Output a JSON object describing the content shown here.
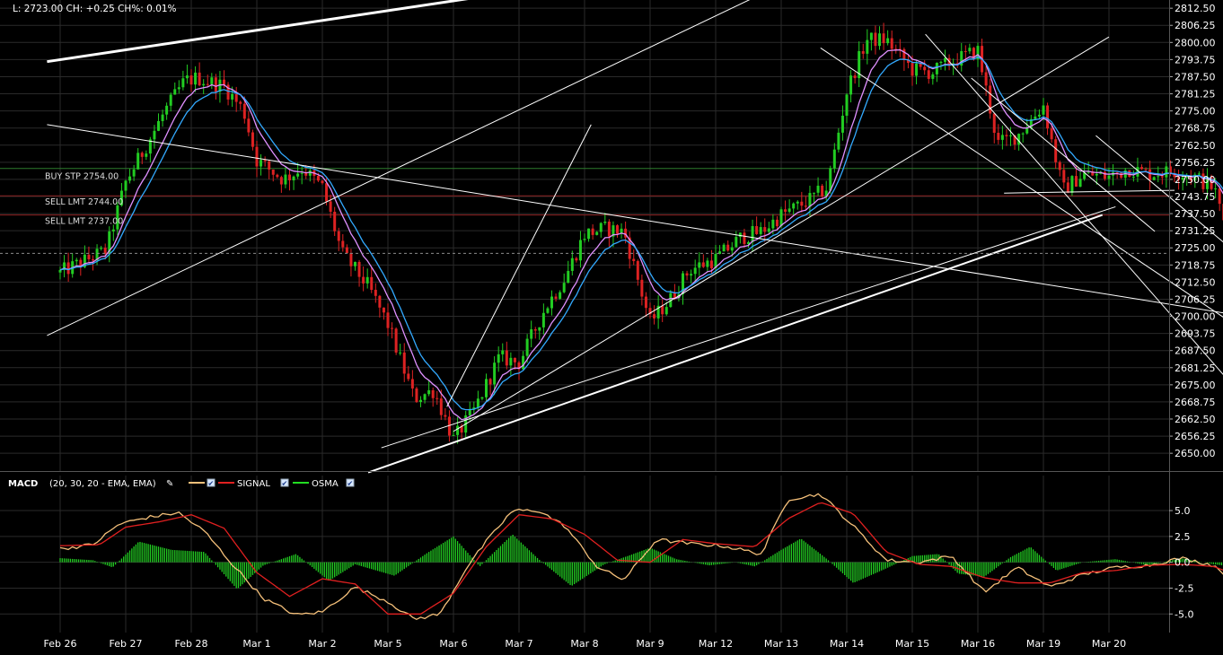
{
  "status": {
    "text": "L: 2723.00 CH: +0.25 CH%: 0.01%"
  },
  "order_lines": [
    {
      "label": "BUY STP 2754.00",
      "price": 2754.0,
      "color": "#2e7d2e"
    },
    {
      "label": "SELL LMT 2744.00",
      "price": 2744.0,
      "color": "#8b1e1e"
    },
    {
      "label": "SELL LMT 2737.00",
      "price": 2737.0,
      "color": "#8b1e1e"
    }
  ],
  "last_price": 2723.0,
  "macd_header": {
    "title": "MACD",
    "params": "(20, 30, 20 - EMA, EMA)",
    "legend": [
      {
        "name": "",
        "color": "#f5c07a"
      },
      {
        "name": "SIGNAL",
        "color": "#e02020"
      },
      {
        "name": "OSMA",
        "color": "#22dd22"
      }
    ]
  },
  "colors": {
    "background": "#000000",
    "grid": "#2a2a2a",
    "up_candle": "#22cc22",
    "down_candle": "#dd2222",
    "ma_fast": "#e090ff",
    "ma_slow": "#33aaff",
    "trendline": "#ffffff",
    "separator": "#555555"
  },
  "chart_data": [
    {
      "type": "candlestick",
      "title": "",
      "price_axis": {
        "ylim": [
          2643.5,
          2815.5
        ],
        "ticks": [
          2812.5,
          2806.25,
          2800.0,
          2793.75,
          2787.5,
          2781.25,
          2775.0,
          2768.75,
          2762.5,
          2756.25,
          2750.0,
          2743.75,
          2737.5,
          2731.25,
          2725.0,
          2718.75,
          2712.5,
          2706.25,
          2700.0,
          2693.75,
          2687.5,
          2681.25,
          2675.0,
          2668.75,
          2662.5,
          2656.25,
          2650.0
        ],
        "tick_labels": [
          "2812.50",
          "2806.25",
          "2800.00",
          "2793.75",
          "2787.50",
          "2781.25",
          "2775.00",
          "2768.75",
          "2762.50",
          "2756.25",
          "2750.00",
          "2743.75",
          "2737.50",
          "2731.25",
          "2725.00",
          "2718.75",
          "2712.50",
          "2706.25",
          "2700.00",
          "2693.75",
          "2687.50",
          "2681.25",
          "2675.00",
          "2668.75",
          "2662.50",
          "2656.25",
          "2650.00"
        ]
      },
      "date_axis": {
        "labels": [
          "Feb 26",
          "Feb 27",
          "Feb 28",
          "Mar 1",
          "Mar 2",
          "Mar 5",
          "Mar 6",
          "Mar 7",
          "Mar 8",
          "Mar 9",
          "Mar 12",
          "Mar 13",
          "Mar 14",
          "Mar 15",
          "Mar 16",
          "Mar 19",
          "Mar 20"
        ],
        "grid": true
      },
      "price_path": [
        [
          0,
          2716
        ],
        [
          0.7,
          2724
        ],
        [
          1.0,
          2749
        ],
        [
          1.35,
          2764
        ],
        [
          1.6,
          2775
        ],
        [
          1.9,
          2786
        ],
        [
          2.1,
          2787
        ],
        [
          2.5,
          2784
        ],
        [
          2.8,
          2775
        ],
        [
          3.0,
          2757
        ],
        [
          3.4,
          2750
        ],
        [
          3.7,
          2754
        ],
        [
          4.0,
          2747
        ],
        [
          4.3,
          2723
        ],
        [
          4.7,
          2711
        ],
        [
          5.0,
          2697
        ],
        [
          5.4,
          2670
        ],
        [
          5.7,
          2673
        ],
        [
          6.0,
          2655
        ],
        [
          6.3,
          2665
        ],
        [
          6.7,
          2685
        ],
        [
          7.0,
          2683
        ],
        [
          7.4,
          2703
        ],
        [
          7.7,
          2714
        ],
        [
          8.0,
          2730
        ],
        [
          8.3,
          2732
        ],
        [
          8.6,
          2731
        ],
        [
          9.0,
          2698
        ],
        [
          9.3,
          2706
        ],
        [
          9.6,
          2717
        ],
        [
          10.0,
          2721
        ],
        [
          10.4,
          2729
        ],
        [
          10.7,
          2731
        ],
        [
          11.0,
          2737
        ],
        [
          11.4,
          2742
        ],
        [
          11.7,
          2747
        ],
        [
          12.0,
          2782
        ],
        [
          12.3,
          2801
        ],
        [
          12.6,
          2801
        ],
        [
          13.0,
          2790
        ],
        [
          13.3,
          2789
        ],
        [
          13.6,
          2793
        ],
        [
          14.0,
          2797
        ],
        [
          14.3,
          2763
        ],
        [
          14.6,
          2766
        ],
        [
          15.0,
          2777
        ],
        [
          15.3,
          2746
        ],
        [
          15.6,
          2752
        ],
        [
          16.0,
          2751
        ],
        [
          16.3,
          2754
        ],
        [
          16.6,
          2752
        ],
        [
          17.0,
          2753
        ],
        [
          17.3,
          2751
        ],
        [
          17.6,
          2747
        ],
        [
          18.0,
          2716
        ],
        [
          18.3,
          2701
        ],
        [
          18.6,
          2723
        ],
        [
          19.0,
          2726
        ],
        [
          19.3,
          2725
        ],
        [
          19.6,
          2724
        ],
        [
          20.2,
          2723
        ]
      ],
      "trendlines": [
        {
          "from": [
            -0.2,
            2793
          ],
          "to": [
            9.3,
            2827
          ],
          "width": 3
        },
        {
          "from": [
            -0.2,
            2770
          ],
          "to": [
            18.6,
            2698
          ],
          "width": 1
        },
        {
          "from": [
            -0.2,
            2693
          ],
          "to": [
            11.6,
            2828
          ],
          "width": 1
        },
        {
          "from": [
            5.9,
            2667
          ],
          "to": [
            8.1,
            2770
          ],
          "width": 1
        },
        {
          "from": [
            6.0,
            2658
          ],
          "to": [
            16.0,
            2802
          ],
          "width": 1
        },
        {
          "from": [
            4.7,
            2643
          ],
          "to": [
            15.9,
            2737
          ],
          "width": 2
        },
        {
          "from": [
            4.9,
            2652
          ],
          "to": [
            16.1,
            2740
          ],
          "width": 1
        },
        {
          "from": [
            11.6,
            2798
          ],
          "to": [
            18.1,
            2694
          ],
          "width": 1
        },
        {
          "from": [
            13.2,
            2803
          ],
          "to": [
            18.1,
            2669
          ],
          "width": 1
        },
        {
          "from": [
            13.9,
            2787
          ],
          "to": [
            16.7,
            2731
          ],
          "width": 1
        },
        {
          "from": [
            15.8,
            2766
          ],
          "to": [
            17.9,
            2724
          ],
          "width": 1
        },
        {
          "from": [
            14.4,
            2745
          ],
          "to": [
            17.0,
            2746
          ],
          "width": 1
        }
      ]
    },
    {
      "type": "line",
      "title": "MACD",
      "y_axis": {
        "ylim": [
          -6.8,
          7.0
        ],
        "ticks": [
          5.0,
          2.5,
          0.0,
          -2.5,
          -5.0
        ],
        "tick_labels": [
          "5.0",
          "2.5",
          "0.0",
          "-2.5",
          "-5.0"
        ]
      },
      "series": [
        {
          "name": "",
          "path": [
            [
              0,
              1.3
            ],
            [
              0.5,
              1.7
            ],
            [
              0.9,
              3.7
            ],
            [
              1.3,
              4.3
            ],
            [
              1.8,
              4.8
            ],
            [
              2.2,
              3.0
            ],
            [
              2.6,
              0.0
            ],
            [
              3.1,
              -3.5
            ],
            [
              3.6,
              -5.1
            ],
            [
              4.0,
              -4.8
            ],
            [
              4.5,
              -2.4
            ],
            [
              5.0,
              -3.8
            ],
            [
              5.4,
              -5.5
            ],
            [
              5.8,
              -5.0
            ],
            [
              6.2,
              -0.5
            ],
            [
              6.5,
              2.0
            ],
            [
              6.9,
              5.0
            ],
            [
              7.3,
              5.0
            ],
            [
              7.7,
              3.5
            ],
            [
              8.2,
              -0.5
            ],
            [
              8.6,
              -1.7
            ],
            [
              9.1,
              2.2
            ],
            [
              9.6,
              1.8
            ],
            [
              10.1,
              1.6
            ],
            [
              10.7,
              0.8
            ],
            [
              11.1,
              6.1
            ],
            [
              11.6,
              6.6
            ],
            [
              12.1,
              3.5
            ],
            [
              12.6,
              0.2
            ],
            [
              13.1,
              0.0
            ],
            [
              13.6,
              0.6
            ],
            [
              14.1,
              -2.9
            ],
            [
              14.6,
              -0.5
            ],
            [
              15.1,
              -2.4
            ],
            [
              15.6,
              -1.2
            ],
            [
              16.1,
              -0.5
            ],
            [
              16.6,
              -0.3
            ],
            [
              17.1,
              0.4
            ],
            [
              17.6,
              -0.3
            ],
            [
              18.1,
              -2.8
            ],
            [
              18.5,
              -5.9
            ],
            [
              19.0,
              -3.4
            ],
            [
              19.5,
              -1.0
            ],
            [
              20.2,
              -0.6
            ]
          ]
        },
        {
          "name": "SIGNAL",
          "path": [
            [
              0,
              1.6
            ],
            [
              0.6,
              1.7
            ],
            [
              1.0,
              3.4
            ],
            [
              1.5,
              3.9
            ],
            [
              2.0,
              4.6
            ],
            [
              2.5,
              3.3
            ],
            [
              3.0,
              -1.0
            ],
            [
              3.5,
              -3.3
            ],
            [
              4.0,
              -1.6
            ],
            [
              4.5,
              -2.1
            ],
            [
              5.0,
              -5.0
            ],
            [
              5.5,
              -5.0
            ],
            [
              6.0,
              -3.0
            ],
            [
              6.5,
              1.5
            ],
            [
              7.0,
              4.6
            ],
            [
              7.5,
              4.2
            ],
            [
              8.0,
              2.7
            ],
            [
              8.5,
              0.2
            ],
            [
              9.0,
              0.0
            ],
            [
              9.5,
              2.2
            ],
            [
              10.0,
              1.8
            ],
            [
              10.6,
              1.5
            ],
            [
              11.1,
              4.2
            ],
            [
              11.6,
              5.8
            ],
            [
              12.1,
              4.7
            ],
            [
              12.6,
              1.0
            ],
            [
              13.1,
              -0.2
            ],
            [
              13.6,
              -0.4
            ],
            [
              14.1,
              -1.5
            ],
            [
              14.6,
              -2.0
            ],
            [
              15.1,
              -2.0
            ],
            [
              15.6,
              -1.0
            ],
            [
              16.1,
              -0.8
            ],
            [
              16.6,
              -0.3
            ],
            [
              17.1,
              -0.2
            ],
            [
              17.6,
              -0.4
            ],
            [
              18.0,
              -1.4
            ],
            [
              18.5,
              -4.2
            ],
            [
              19.0,
              -3.8
            ],
            [
              19.5,
              -2.2
            ],
            [
              20.2,
              -0.9
            ]
          ]
        }
      ],
      "osma": {
        "name": "OSMA",
        "path": [
          [
            0,
            0.4
          ],
          [
            0.5,
            0.2
          ],
          [
            0.8,
            -0.5
          ],
          [
            1.2,
            2.0
          ],
          [
            1.7,
            1.2
          ],
          [
            2.2,
            1.0
          ],
          [
            2.7,
            -2.6
          ],
          [
            3.1,
            -0.3
          ],
          [
            3.6,
            0.8
          ],
          [
            4.1,
            -1.8
          ],
          [
            4.5,
            -0.2
          ],
          [
            5.1,
            -1.3
          ],
          [
            5.6,
            0.9
          ],
          [
            6.0,
            2.5
          ],
          [
            6.4,
            -0.4
          ],
          [
            6.9,
            2.7
          ],
          [
            7.3,
            0.3
          ],
          [
            7.8,
            -2.3
          ],
          [
            8.3,
            -0.2
          ],
          [
            8.7,
            0.7
          ],
          [
            9.0,
            1.4
          ],
          [
            9.4,
            0.3
          ],
          [
            9.9,
            -0.3
          ],
          [
            10.3,
            0.0
          ],
          [
            10.6,
            -0.4
          ],
          [
            11.0,
            1.2
          ],
          [
            11.3,
            2.3
          ],
          [
            11.7,
            0.3
          ],
          [
            12.1,
            -2.0
          ],
          [
            12.6,
            -0.6
          ],
          [
            13.0,
            0.6
          ],
          [
            13.4,
            0.8
          ],
          [
            13.7,
            -1.1
          ],
          [
            14.1,
            -1.4
          ],
          [
            14.5,
            0.5
          ],
          [
            14.8,
            1.5
          ],
          [
            15.2,
            -0.8
          ],
          [
            15.6,
            0.0
          ],
          [
            16.1,
            0.3
          ],
          [
            16.6,
            -0.3
          ],
          [
            17.1,
            0.4
          ],
          [
            17.6,
            -0.2
          ],
          [
            18.0,
            -0.5
          ],
          [
            18.4,
            -0.8
          ],
          [
            18.7,
            0.9
          ],
          [
            19.1,
            0.2
          ],
          [
            19.5,
            1.4
          ],
          [
            19.8,
            1.1
          ],
          [
            20.2,
            0.3
          ]
        ]
      }
    }
  ]
}
